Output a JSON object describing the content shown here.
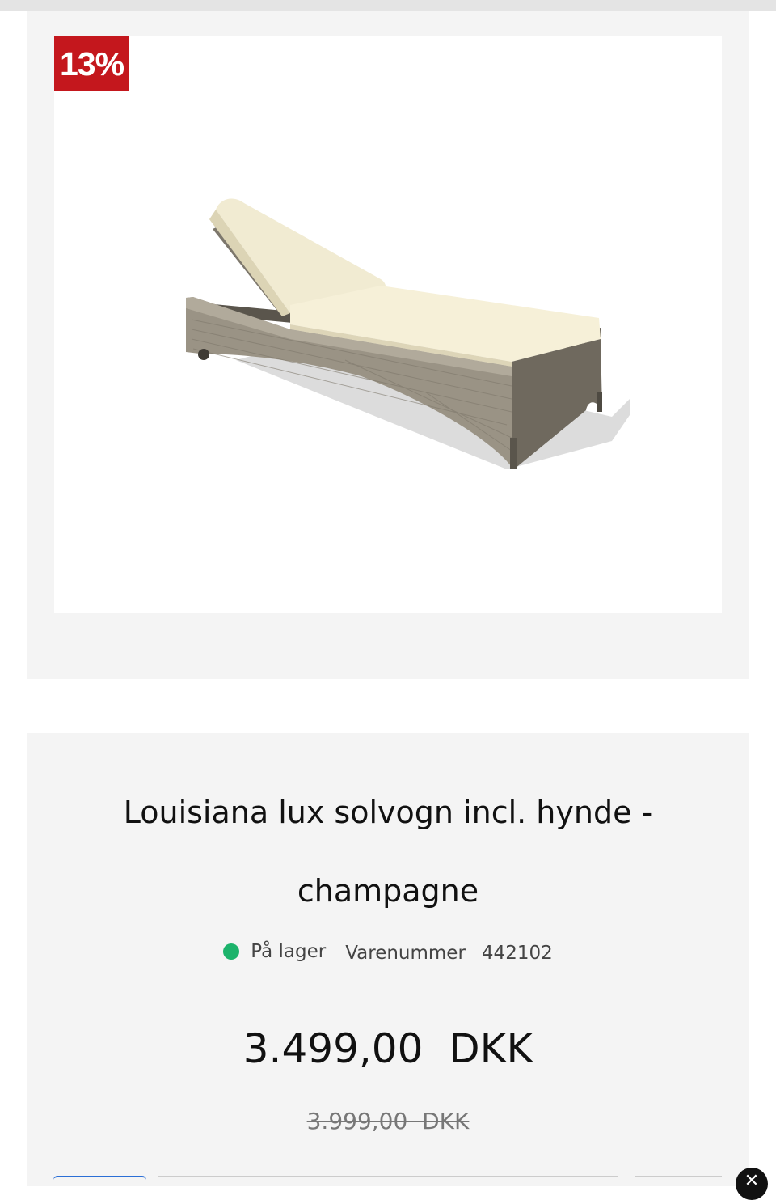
{
  "product": {
    "discount_badge": "13%",
    "title": "Louisiana lux solvogn incl. hynde - champagne",
    "image_alt": "Louisiana lux solvogn med champagne hynde",
    "stock_status": "På lager",
    "stock_color": "#1cb36b",
    "sku_label": "Varenummer",
    "sku_value": "442102",
    "price_current": "3.499,00  DKK",
    "price_old": "3.999,00  DKK"
  },
  "theme": {
    "badge_color": "#c4171d",
    "panel_background": "#f4f4f4"
  },
  "icons": {
    "close": "close-icon"
  }
}
